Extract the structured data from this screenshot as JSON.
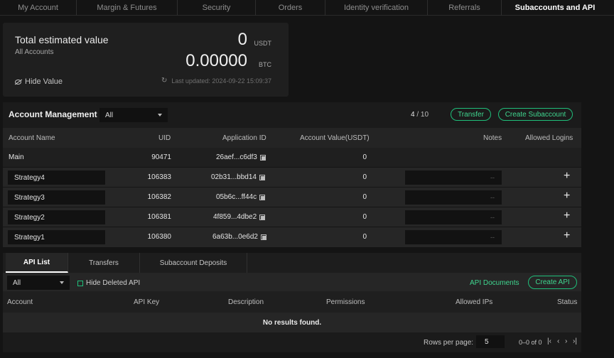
{
  "nav": {
    "tabs": [
      {
        "label": "My Account"
      },
      {
        "label": "Margin & Futures"
      },
      {
        "label": "Security"
      },
      {
        "label": "Orders"
      },
      {
        "label": "Identity verification"
      },
      {
        "label": "Referrals"
      },
      {
        "label": "Subaccounts and API"
      }
    ],
    "active_tab": "Subaccounts and API"
  },
  "value_card": {
    "title": "Total estimated value",
    "subtitle": "All Accounts",
    "usdt_value": "0",
    "usdt_unit": "USDT",
    "btc_value": "0.00000",
    "btc_unit": "BTC",
    "hide_label": "Hide Value",
    "hide_icon": "eye-slash-icon",
    "updated_icon": "refresh-icon",
    "last_updated": "Last updated: 2024-09-22 15:09:37"
  },
  "account_management": {
    "title": "Account Management",
    "filter_value": "All",
    "count_current": "4",
    "count_max": "/ 10",
    "transfer_label": "Transfer",
    "create_label": "Create Subaccount",
    "columns": [
      "Account Name",
      "UID",
      "Application ID",
      "Account Value(USDT)",
      "Notes",
      "Allowed Logins"
    ],
    "rows": [
      {
        "name": "Main",
        "uid": "90471",
        "app_id": "26aef...c6df3",
        "value": "0",
        "notes": "",
        "type": "main"
      },
      {
        "name": "Strategy4",
        "uid": "106383",
        "app_id": "02b31...bbd14",
        "value": "0",
        "notes": "--",
        "type": "sub"
      },
      {
        "name": "Strategy3",
        "uid": "106382",
        "app_id": "05b6c...ff44c",
        "value": "0",
        "notes": "--",
        "type": "sub"
      },
      {
        "name": "Strategy2",
        "uid": "106381",
        "app_id": "4f859...4dbe2",
        "value": "0",
        "notes": "--",
        "type": "sub"
      },
      {
        "name": "Strategy1",
        "uid": "106380",
        "app_id": "6a63b...0e6d2",
        "value": "0",
        "notes": "--",
        "type": "sub"
      }
    ],
    "add_symbol": "+"
  },
  "api": {
    "tabs": [
      "API List",
      "Transfers",
      "Subaccount Deposits"
    ],
    "active_tab": "API List",
    "filter_value": "All",
    "hide_deleted_label": "Hide Deleted API",
    "documents_label": "API Documents",
    "create_label": "Create API",
    "columns": [
      "Account",
      "API Key",
      "Description",
      "Permissions",
      "Allowed IPs",
      "Status"
    ],
    "empty_message": "No results found.",
    "rows_per_page_label": "Rows per page:",
    "rows_per_page": "5",
    "range": "0–0 of 0",
    "nav_first": "|‹",
    "nav_prev": "‹",
    "nav_next": "›",
    "nav_last": "›|"
  },
  "colors": {
    "accent": "#1fbf7a",
    "background": "#141414",
    "panel": "#1b1b1b"
  }
}
